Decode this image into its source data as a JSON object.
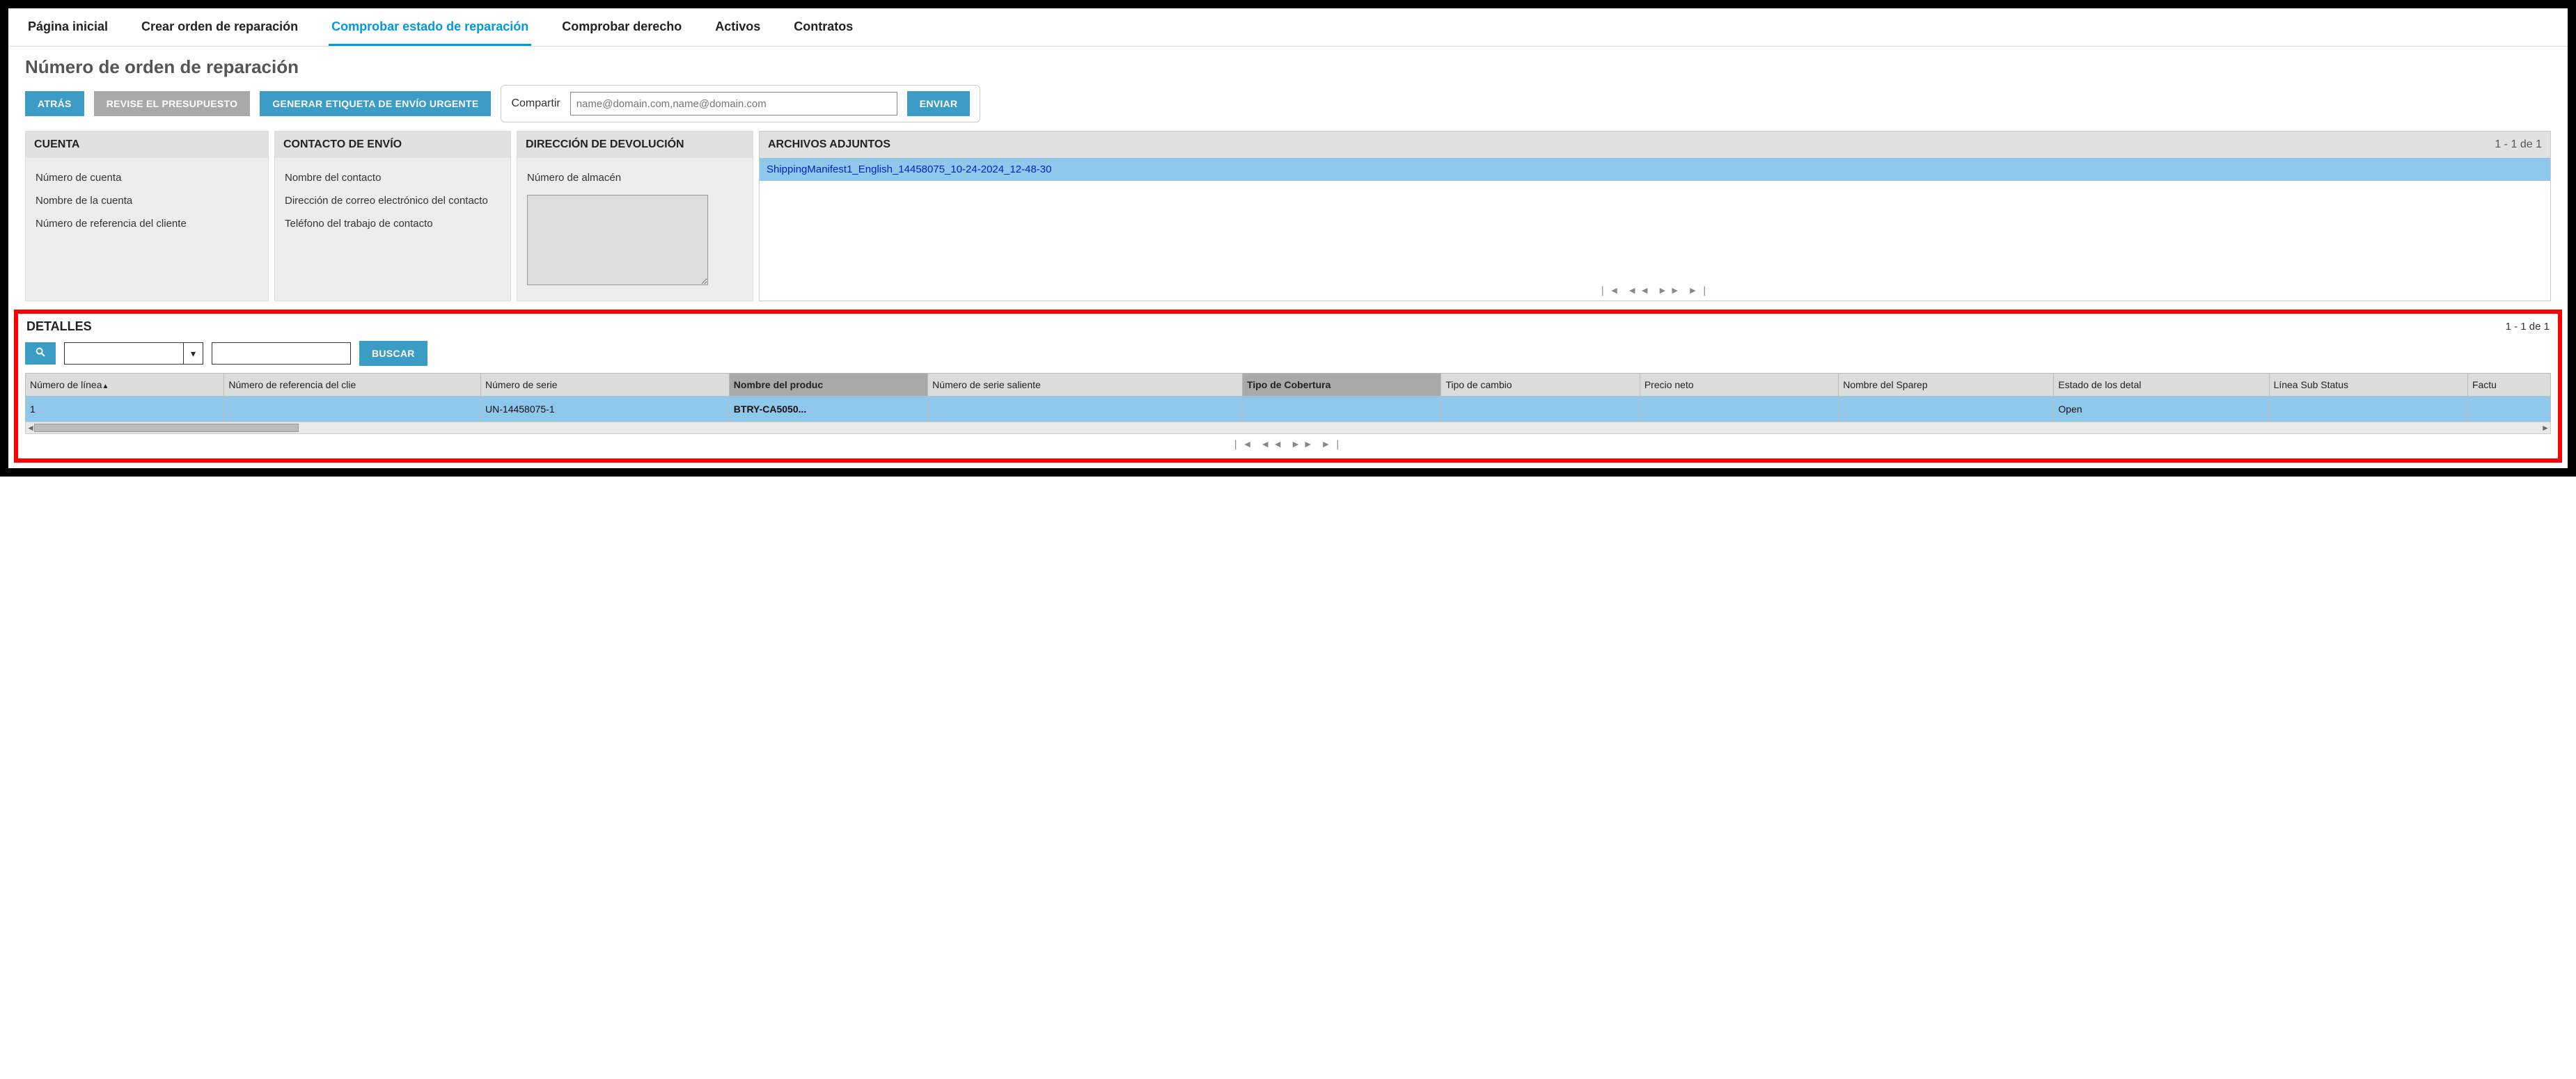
{
  "tabs": {
    "home": "Página inicial",
    "create": "Crear orden de reparación",
    "status": "Comprobar estado de reparación",
    "entitlement": "Comprobar derecho",
    "assets": "Activos",
    "contracts": "Contratos"
  },
  "page_title": "Número de orden de reparación",
  "buttons": {
    "back": "ATRÁS",
    "review_quote": "REVISE EL PRESUPUESTO",
    "gen_label": "GENERAR ETIQUETA DE ENVÍO URGENTE",
    "send": "ENVIAR",
    "search": "BUSCAR"
  },
  "share": {
    "label": "Compartir",
    "placeholder": "name@domain.com,name@domain.com"
  },
  "panels": {
    "account": {
      "title": "CUENTA",
      "acct_num": "Número de cuenta",
      "acct_name": "Nombre de la cuenta",
      "cust_ref": "Número de referencia del cliente"
    },
    "contact": {
      "title": "CONTACTO DE ENVÍO",
      "name": "Nombre del contacto",
      "email": "Dirección de correo electrónico del contacto",
      "phone": "Teléfono del trabajo de contacto"
    },
    "return": {
      "title": "DIRECCIÓN DE DEVOLUCIÓN",
      "wh": "Número de almacén"
    },
    "attachments": {
      "title": "ARCHIVOS ADJUNTOS",
      "count": "1 - 1 de 1",
      "items": [
        "ShippingManifest1_English_14458075_10-24-2024_12-48-30"
      ]
    }
  },
  "details": {
    "title": "DETALLES",
    "count": "1 - 1 de 1",
    "columns": {
      "line": "Número de línea",
      "cust_ref": "Número de referencia del clie",
      "serial": "Número de serie",
      "product": "Nombre del produc",
      "out_serial": "Número de serie saliente",
      "coverage": "Tipo de Cobertura",
      "exchange": "Tipo de cambio",
      "net": "Precio neto",
      "sparep": "Nombre del Sparep",
      "status": "Estado de los detal",
      "substatus": "Línea Sub Status",
      "invoice": "Factu"
    },
    "rows": [
      {
        "line": "1",
        "cust_ref": "",
        "serial": "UN-14458075-1",
        "product": "BTRY-CA5050...",
        "out_serial": "",
        "coverage": "",
        "exchange": "",
        "net": "",
        "sparep": "",
        "status": "Open",
        "substatus": "",
        "invoice": ""
      }
    ]
  },
  "pager_glyphs": "❘◄  ◄◄  ►►  ►❘"
}
